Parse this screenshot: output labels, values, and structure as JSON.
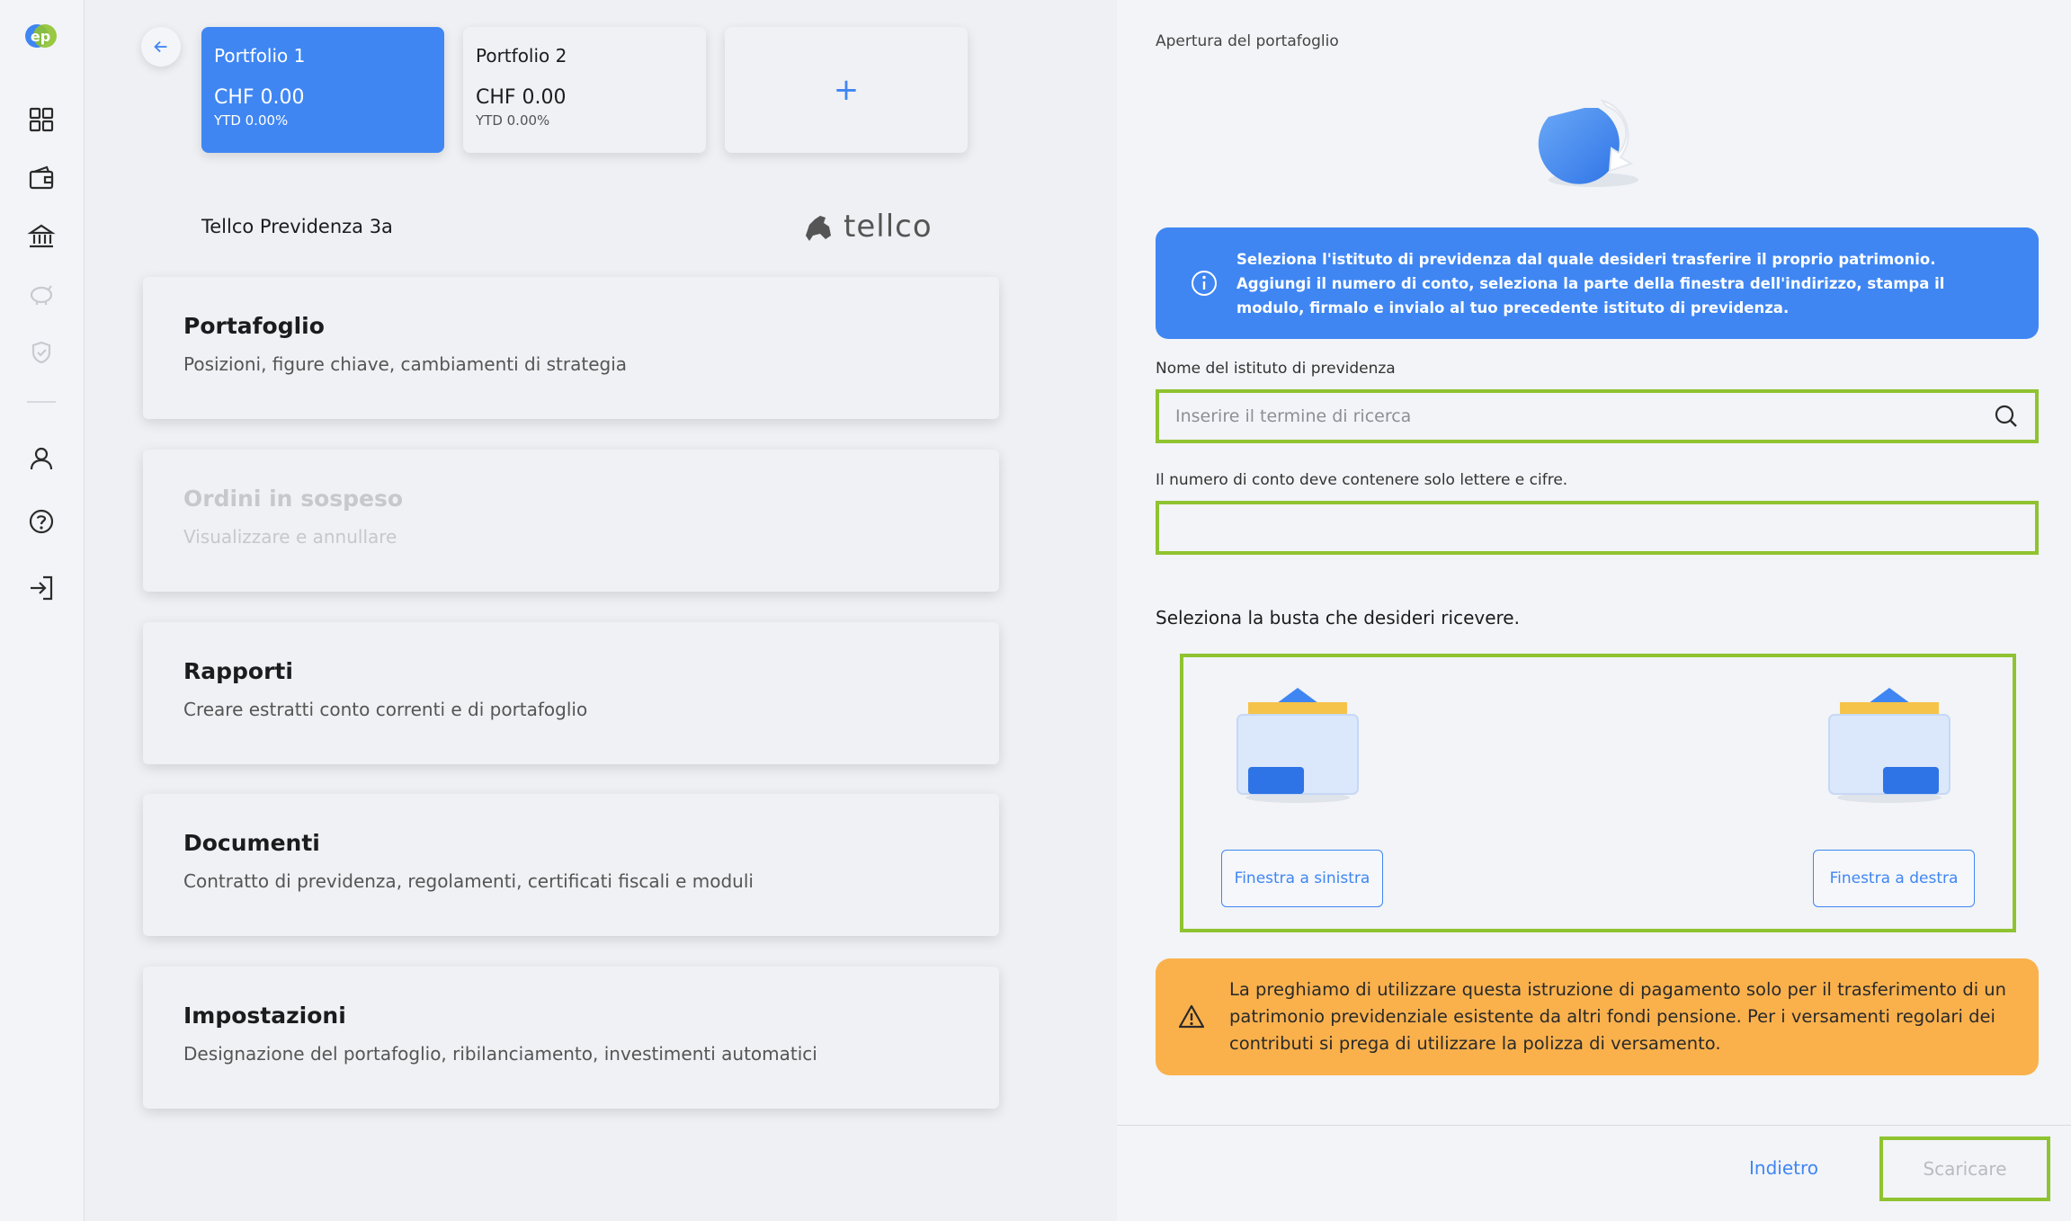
{
  "sidebar": {
    "logo_text": "ep",
    "icons": [
      "grid-icon",
      "wallet-icon",
      "bank-icon",
      "piggy-bank-icon",
      "shield-icon",
      "user-icon",
      "help-icon",
      "login-icon"
    ]
  },
  "portfolios": [
    {
      "name": "Portfolio 1",
      "value": "CHF 0.00",
      "ytd": "YTD 0.00%",
      "active": true
    },
    {
      "name": "Portfolio 2",
      "value": "CHF 0.00",
      "ytd": "YTD 0.00%",
      "active": false
    }
  ],
  "add_label": "+",
  "provider": {
    "title": "Tellco Previdenza 3a",
    "brand": "tellco"
  },
  "menu": [
    {
      "title": "Portafoglio",
      "subtitle": "Posizioni, figure chiave, cambiamenti di strategia",
      "disabled": false
    },
    {
      "title": "Ordini in sospeso",
      "subtitle": "Visualizzare e annullare",
      "disabled": true
    },
    {
      "title": "Rapporti",
      "subtitle": "Creare estratti conto correnti e di portafoglio",
      "disabled": false
    },
    {
      "title": "Documenti",
      "subtitle": "Contratto di previdenza, regolamenti, certificati fiscali e moduli",
      "disabled": false
    },
    {
      "title": "Impostazioni",
      "subtitle": "Designazione del portafoglio, ribilanciamento, investimenti automatici",
      "disabled": false
    }
  ],
  "panel": {
    "heading": "Apertura del portafoglio",
    "info": "Seleziona l'istituto di previdenza dal quale desideri trasferire il proprio patrimonio. Aggiungi il numero di conto, seleziona la parte della finestra dell'indirizzo, stampa il modulo, firmalo e invialo al tuo precedente istituto di previdenza.",
    "institution_label": "Nome del istituto di previdenza",
    "search_placeholder": "Inserire il termine di ricerca",
    "account_label": "Il numero di conto deve contenere solo lettere e cifre.",
    "account_value": "",
    "envelope_question": "Seleziona la busta che desideri ricevere.",
    "envelope_left": "Finestra a sinistra",
    "envelope_right": "Finestra a destra",
    "warning": "La preghiamo di utilizzare questa istruzione di pagamento solo per il trasferimento di un patrimonio previdenziale esistente da altri fondi pensione. Per i versamenti regolari dei contributi si prega di utilizzare la polizza di versamento.",
    "back_label": "Indietro",
    "download_label": "Scaricare"
  },
  "colors": {
    "accent": "#3f86f3",
    "warning": "#fab14c",
    "highlight": "#8fc330"
  }
}
